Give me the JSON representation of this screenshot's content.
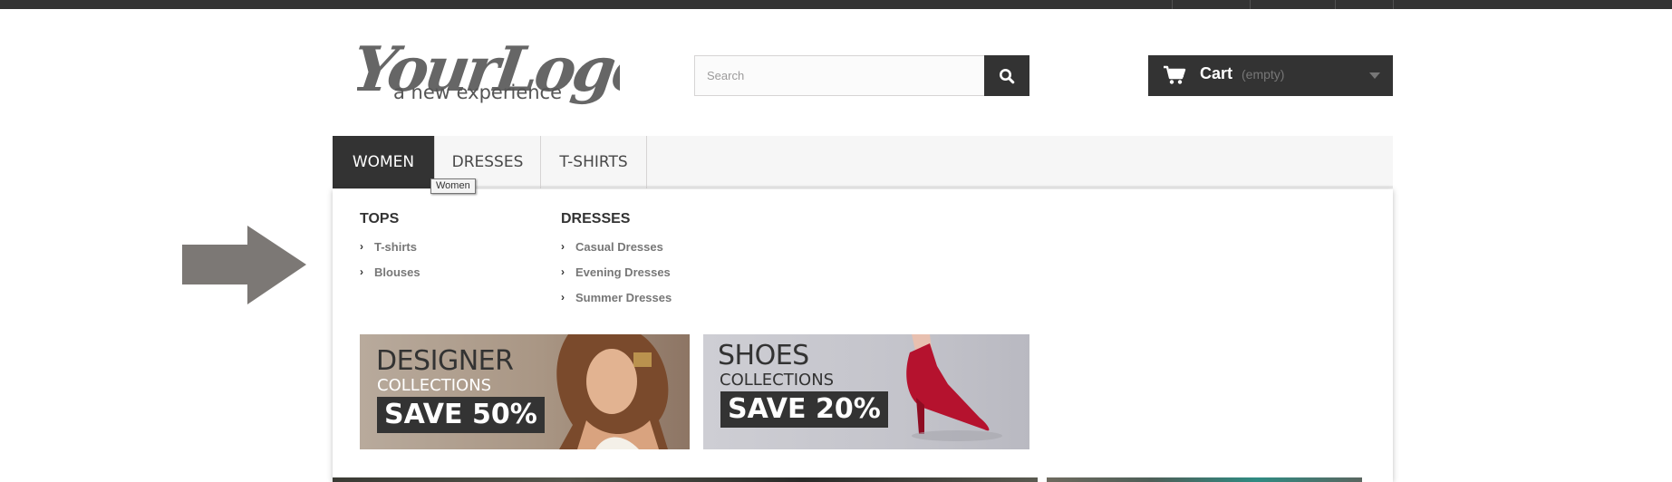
{
  "logo": {
    "main": "YourLogo",
    "tagline": "a new experience"
  },
  "search": {
    "placeholder": "Search",
    "icon": "search-icon"
  },
  "cart": {
    "label": "Cart",
    "status": "(empty)",
    "icon": "cart-icon"
  },
  "nav": {
    "tabs": [
      {
        "label": "WOMEN",
        "active": true
      },
      {
        "label": "DRESSES"
      },
      {
        "label": "T-SHIRTS"
      }
    ]
  },
  "tooltip": "Women",
  "dropdown": {
    "columns": [
      {
        "title": "TOPS",
        "items": [
          "T-shirts",
          "Blouses"
        ]
      },
      {
        "title": "DRESSES",
        "items": [
          "Casual Dresses",
          "Evening Dresses",
          "Summer Dresses"
        ]
      }
    ],
    "banners": [
      {
        "title": "DESIGNER",
        "subtitle": "COLLECTIONS",
        "offer": "SAVE 50%"
      },
      {
        "title": "SHOES",
        "subtitle": "COLLECTIONS",
        "offer": "SAVE 20%"
      }
    ]
  },
  "colors": {
    "dark": "#333333",
    "nav_bg": "#f6f6f6",
    "arrow": "#7c7875",
    "link": "#777777"
  }
}
